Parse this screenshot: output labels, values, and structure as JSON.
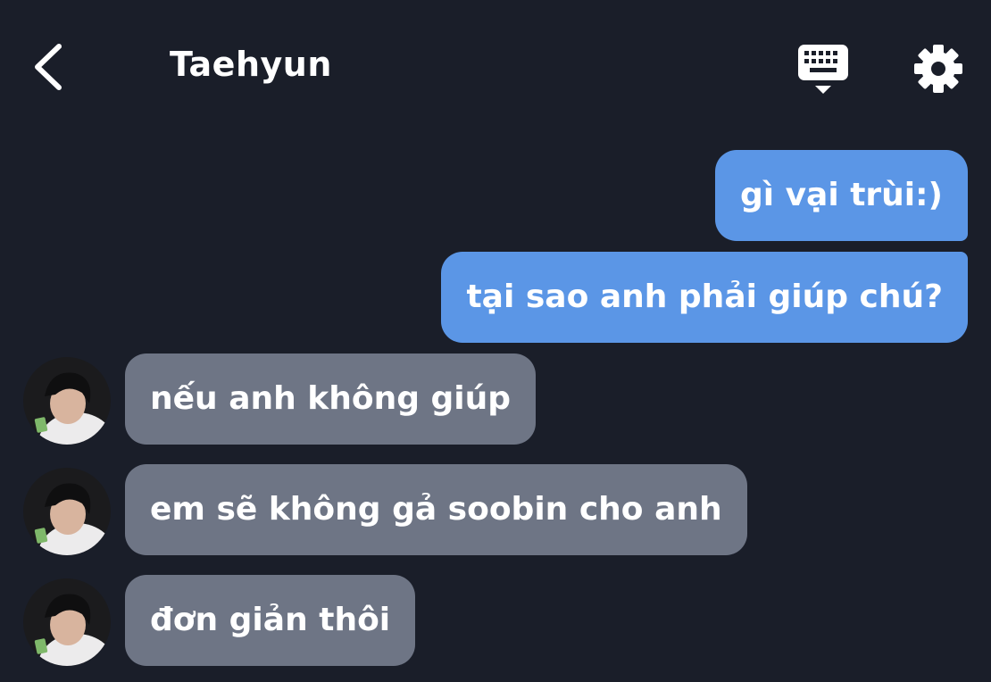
{
  "header": {
    "title": "Taehyun",
    "back_icon": "chevron-left-icon",
    "keyboard_icon": "keyboard-icon",
    "settings_icon": "gear-icon"
  },
  "colors": {
    "background": "#1a1e29",
    "outgoing_bubble": "#5b96e6",
    "incoming_bubble": "#6e7585",
    "text": "#ffffff"
  },
  "messages": [
    {
      "sender": "me",
      "text": "gì vại trùi:)"
    },
    {
      "sender": "me",
      "text": "tại sao anh phải giúp chú?"
    },
    {
      "sender": "Taehyun",
      "text": "nếu anh không giúp"
    },
    {
      "sender": "Taehyun",
      "text": "em sẽ không gả soobin cho anh"
    },
    {
      "sender": "Taehyun",
      "text": "đơn giản thôi"
    }
  ]
}
